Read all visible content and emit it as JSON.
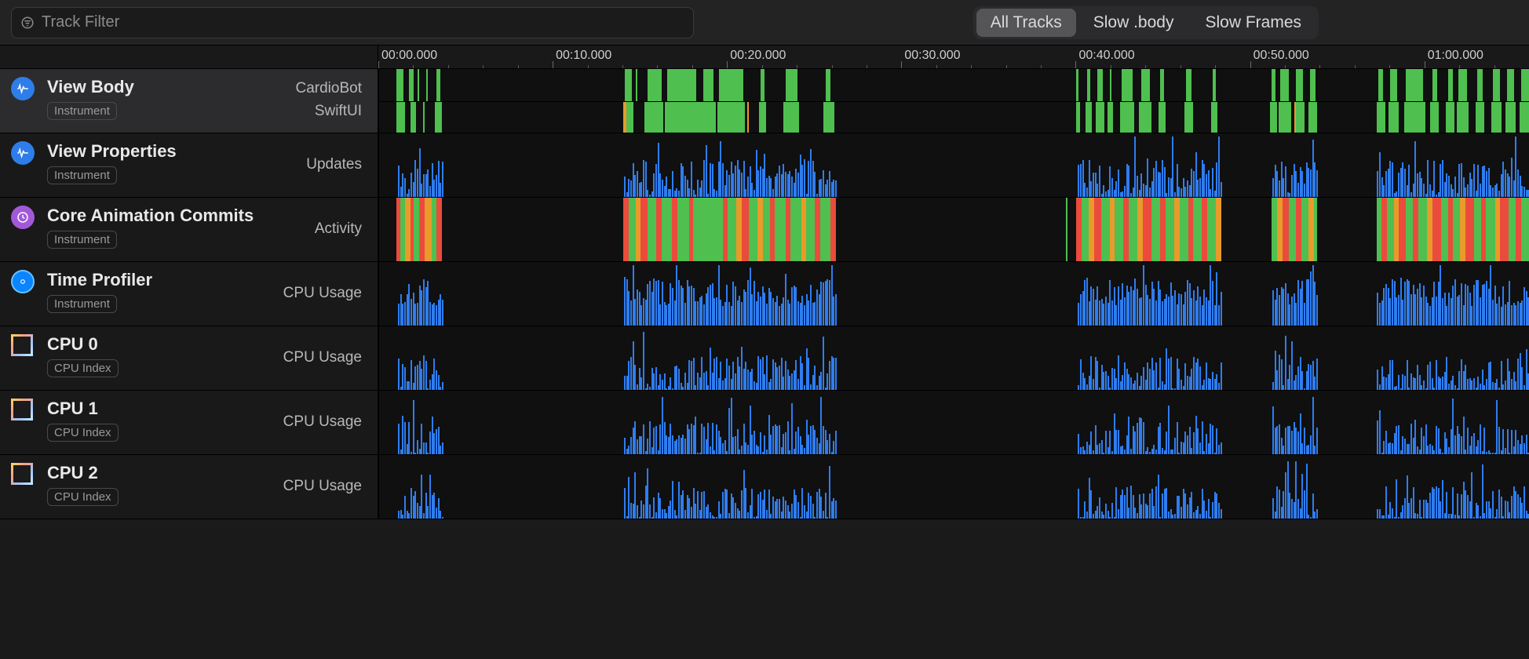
{
  "filter": {
    "placeholder": "Track Filter"
  },
  "segmented": {
    "all": "All Tracks",
    "slowbody": "Slow .body",
    "slowframes": "Slow Frames",
    "active": "all"
  },
  "timeline": {
    "start_ms": 0,
    "end_ms": 66000,
    "majors": [
      "00:00.000",
      "00:10.000",
      "00:20.000",
      "00:30.000",
      "00:40.000",
      "00:50.000",
      "01:00.000"
    ],
    "major_step_ms": 10000,
    "minor_step_ms": 2000
  },
  "tracks": [
    {
      "id": "view-body",
      "title": "View Body",
      "tag": "Instrument",
      "icon": "wave-blue",
      "selected": true,
      "lanes": [
        {
          "label": "CardioBot"
        },
        {
          "label": "SwiftUI"
        }
      ]
    },
    {
      "id": "view-props",
      "title": "View Properties",
      "tag": "Instrument",
      "icon": "wave-blue",
      "lanes": [
        {
          "label": "Updates"
        }
      ]
    },
    {
      "id": "core-anim",
      "title": "Core Animation Commits",
      "tag": "Instrument",
      "icon": "clock-purple",
      "lanes": [
        {
          "label": "Activity"
        }
      ]
    },
    {
      "id": "time-profiler",
      "title": "Time Profiler",
      "tag": "Instrument",
      "icon": "target-cyan",
      "lanes": [
        {
          "label": "CPU Usage"
        }
      ]
    },
    {
      "id": "cpu0",
      "title": "CPU 0",
      "tag": "CPU Index",
      "icon": "cpu",
      "lanes": [
        {
          "label": "CPU Usage"
        }
      ]
    },
    {
      "id": "cpu1",
      "title": "CPU 1",
      "tag": "CPU Index",
      "icon": "cpu",
      "lanes": [
        {
          "label": "CPU Usage"
        }
      ]
    },
    {
      "id": "cpu2",
      "title": "CPU 2",
      "tag": "CPU Index",
      "icon": "cpu",
      "lanes": [
        {
          "label": "CPU Usage"
        }
      ]
    }
  ],
  "chart_data": {
    "type": "timeline",
    "x_unit": "ms",
    "x_range": [
      0,
      66000
    ],
    "activity_clusters_ms": [
      [
        1000,
        3600
      ],
      [
        14000,
        26200
      ],
      [
        40000,
        48300
      ],
      [
        51200,
        53800
      ],
      [
        57200,
        66000
      ]
    ],
    "view_body_cardiobot_segments_ms": [
      [
        1000,
        1400,
        "g"
      ],
      [
        1700,
        2000,
        "g"
      ],
      [
        2200,
        2300,
        "g"
      ],
      [
        2700,
        2800,
        "g"
      ],
      [
        3300,
        3500,
        "g"
      ],
      [
        14100,
        14500,
        "g"
      ],
      [
        14700,
        14800,
        "g"
      ],
      [
        15400,
        16200,
        "g"
      ],
      [
        16500,
        18200,
        "g"
      ],
      [
        18600,
        19200,
        "g"
      ],
      [
        19500,
        20900,
        "g"
      ],
      [
        21900,
        22100,
        "g"
      ],
      [
        23300,
        24000,
        "g"
      ],
      [
        25600,
        25900,
        "g"
      ],
      [
        40000,
        40100,
        "g"
      ],
      [
        40600,
        40800,
        "g"
      ],
      [
        41200,
        41500,
        "g"
      ],
      [
        41900,
        42000,
        "g"
      ],
      [
        42600,
        43200,
        "g"
      ],
      [
        43700,
        44200,
        "g"
      ],
      [
        44800,
        45000,
        "g"
      ],
      [
        46300,
        46600,
        "g"
      ],
      [
        47800,
        48000,
        "g"
      ],
      [
        51200,
        51400,
        "g"
      ],
      [
        51700,
        52200,
        "g"
      ],
      [
        52600,
        53000,
        "g"
      ],
      [
        53400,
        53700,
        "g"
      ],
      [
        57300,
        57600,
        "g"
      ],
      [
        58000,
        58400,
        "g"
      ],
      [
        58900,
        59900,
        "g"
      ],
      [
        60400,
        60700,
        "g"
      ],
      [
        61300,
        61600,
        "g"
      ],
      [
        61900,
        62400,
        "g"
      ],
      [
        63000,
        63300,
        "g"
      ],
      [
        63900,
        64300,
        "g"
      ],
      [
        64700,
        65100,
        "g"
      ],
      [
        65500,
        66000,
        "g"
      ]
    ],
    "view_body_swiftui_segments_ms": [
      [
        1000,
        1500,
        "g"
      ],
      [
        1800,
        2100,
        "g"
      ],
      [
        2500,
        2600,
        "g"
      ],
      [
        3200,
        3600,
        "g"
      ],
      [
        14000,
        14200,
        "o"
      ],
      [
        14200,
        14600,
        "g"
      ],
      [
        15200,
        16300,
        "g"
      ],
      [
        16400,
        19300,
        "g"
      ],
      [
        19400,
        21000,
        "g"
      ],
      [
        21100,
        21200,
        "o"
      ],
      [
        21800,
        22200,
        "g"
      ],
      [
        23200,
        24100,
        "g"
      ],
      [
        25500,
        26100,
        "g"
      ],
      [
        40000,
        40200,
        "g"
      ],
      [
        40500,
        40900,
        "g"
      ],
      [
        41100,
        41600,
        "g"
      ],
      [
        41800,
        42100,
        "g"
      ],
      [
        42500,
        43300,
        "g"
      ],
      [
        43600,
        44300,
        "g"
      ],
      [
        44700,
        45100,
        "g"
      ],
      [
        46200,
        46700,
        "g"
      ],
      [
        47700,
        48100,
        "g"
      ],
      [
        51100,
        51500,
        "g"
      ],
      [
        51600,
        52300,
        "g"
      ],
      [
        52500,
        52600,
        "o"
      ],
      [
        52600,
        53100,
        "g"
      ],
      [
        53300,
        53800,
        "g"
      ],
      [
        57200,
        57700,
        "g"
      ],
      [
        57900,
        58500,
        "g"
      ],
      [
        58800,
        60000,
        "g"
      ],
      [
        60300,
        60800,
        "g"
      ],
      [
        61200,
        61700,
        "g"
      ],
      [
        61800,
        62500,
        "g"
      ],
      [
        62900,
        63400,
        "g"
      ],
      [
        63800,
        64400,
        "g"
      ],
      [
        64600,
        65200,
        "g"
      ],
      [
        65400,
        66000,
        "g"
      ]
    ],
    "core_animation_segments_ms": [
      [
        1000,
        1200,
        "r"
      ],
      [
        1200,
        1500,
        "g"
      ],
      [
        1500,
        1800,
        "o"
      ],
      [
        1800,
        2000,
        "r"
      ],
      [
        2000,
        2300,
        "g"
      ],
      [
        2300,
        2600,
        "r"
      ],
      [
        2600,
        3000,
        "o"
      ],
      [
        3000,
        3300,
        "g"
      ],
      [
        3300,
        3600,
        "r"
      ],
      [
        14000,
        14300,
        "r"
      ],
      [
        14300,
        14700,
        "g"
      ],
      [
        14700,
        15000,
        "o"
      ],
      [
        15000,
        15400,
        "r"
      ],
      [
        15400,
        15900,
        "g"
      ],
      [
        15900,
        16200,
        "r"
      ],
      [
        16200,
        16800,
        "g"
      ],
      [
        16800,
        17100,
        "r"
      ],
      [
        17100,
        17800,
        "g"
      ],
      [
        17800,
        18000,
        "r"
      ],
      [
        18000,
        19700,
        "g"
      ],
      [
        19700,
        20000,
        "r"
      ],
      [
        20000,
        20500,
        "g"
      ],
      [
        20500,
        20800,
        "o"
      ],
      [
        20800,
        21200,
        "r"
      ],
      [
        21200,
        21700,
        "g"
      ],
      [
        21700,
        22000,
        "o"
      ],
      [
        22000,
        22400,
        "g"
      ],
      [
        22400,
        22700,
        "r"
      ],
      [
        22700,
        23300,
        "g"
      ],
      [
        23300,
        23600,
        "r"
      ],
      [
        23600,
        24200,
        "g"
      ],
      [
        24200,
        24500,
        "o"
      ],
      [
        24500,
        25000,
        "g"
      ],
      [
        25000,
        25300,
        "r"
      ],
      [
        25300,
        25900,
        "g"
      ],
      [
        25900,
        26200,
        "r"
      ],
      [
        39400,
        39500,
        "g"
      ],
      [
        40000,
        40300,
        "r"
      ],
      [
        40300,
        40700,
        "g"
      ],
      [
        40700,
        41000,
        "o"
      ],
      [
        41000,
        41400,
        "r"
      ],
      [
        41400,
        41900,
        "g"
      ],
      [
        41900,
        42200,
        "o"
      ],
      [
        42200,
        42700,
        "g"
      ],
      [
        42700,
        43000,
        "r"
      ],
      [
        43000,
        43500,
        "g"
      ],
      [
        43500,
        43800,
        "o"
      ],
      [
        43800,
        44300,
        "r"
      ],
      [
        44300,
        44800,
        "g"
      ],
      [
        44800,
        45100,
        "r"
      ],
      [
        45100,
        45600,
        "g"
      ],
      [
        45600,
        45900,
        "o"
      ],
      [
        45900,
        46400,
        "g"
      ],
      [
        46400,
        46700,
        "r"
      ],
      [
        46700,
        47200,
        "g"
      ],
      [
        47200,
        47500,
        "r"
      ],
      [
        47500,
        48000,
        "g"
      ],
      [
        48000,
        48300,
        "o"
      ],
      [
        51200,
        51500,
        "g"
      ],
      [
        51500,
        51800,
        "o"
      ],
      [
        51800,
        52200,
        "r"
      ],
      [
        52200,
        52600,
        "g"
      ],
      [
        52600,
        52900,
        "r"
      ],
      [
        52900,
        53300,
        "g"
      ],
      [
        53300,
        53600,
        "o"
      ],
      [
        53600,
        53800,
        "g"
      ],
      [
        57200,
        57500,
        "g"
      ],
      [
        57500,
        57800,
        "r"
      ],
      [
        57800,
        58200,
        "g"
      ],
      [
        58200,
        58500,
        "o"
      ],
      [
        58500,
        58900,
        "r"
      ],
      [
        58900,
        59300,
        "g"
      ],
      [
        59300,
        59600,
        "r"
      ],
      [
        59600,
        60100,
        "g"
      ],
      [
        60100,
        60400,
        "o"
      ],
      [
        60400,
        60900,
        "r"
      ],
      [
        60900,
        61300,
        "g"
      ],
      [
        61300,
        61600,
        "r"
      ],
      [
        61600,
        62000,
        "g"
      ],
      [
        62000,
        62300,
        "o"
      ],
      [
        62300,
        62800,
        "r"
      ],
      [
        62800,
        63200,
        "g"
      ],
      [
        63200,
        63500,
        "r"
      ],
      [
        63500,
        64000,
        "g"
      ],
      [
        64000,
        64300,
        "o"
      ],
      [
        64300,
        64800,
        "r"
      ],
      [
        64800,
        65200,
        "g"
      ],
      [
        65200,
        65500,
        "r"
      ],
      [
        65500,
        66000,
        "g"
      ]
    ],
    "cpu_profiles": {
      "time_profiler": {
        "base": 0.55,
        "var": 0.45,
        "seed": 1
      },
      "cpu0": {
        "base": 0.3,
        "var": 0.55,
        "seed": 2
      },
      "cpu1": {
        "base": 0.28,
        "var": 0.55,
        "seed": 3
      },
      "cpu2": {
        "base": 0.28,
        "var": 0.55,
        "seed": 4
      },
      "updates": {
        "base": 0.35,
        "var": 0.6,
        "seed": 5
      }
    }
  },
  "colors": {
    "green": "#4fbf4f",
    "red": "#ea4b3c",
    "orange": "#e89a2a",
    "blue": "#2f7df0"
  }
}
